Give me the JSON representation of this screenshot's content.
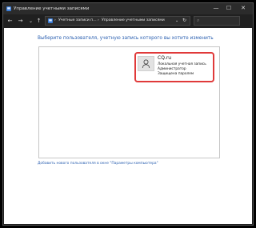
{
  "window": {
    "title": "Управление учетными записями",
    "minimize_glyph": "—",
    "maximize_glyph": "☐",
    "close_glyph": "✕"
  },
  "address_bar": {
    "back_glyph": "←",
    "forward_glyph": "→",
    "up_glyph": "↑",
    "breadcrumb": [
      "Учетные записи п...",
      "Управление учетными записями"
    ],
    "separator": "›",
    "dropdown_glyph": "⌄",
    "refresh_glyph": "↻",
    "search_glyph": "⌕"
  },
  "page": {
    "heading": "Выберите пользователя, учетную запись которого вы хотите изменить",
    "add_user_link": "Добавить нового пользователя в окне \"Параметры компьютера\""
  },
  "account": {
    "name": "CQ.ru",
    "lines": [
      "Локальная учетная запись",
      "Администратор",
      "Защищена паролем"
    ],
    "highlight_color": "#e03a3a"
  },
  "colors": {
    "link": "#2a5fb0",
    "titlebar": "#2b2b2b"
  }
}
